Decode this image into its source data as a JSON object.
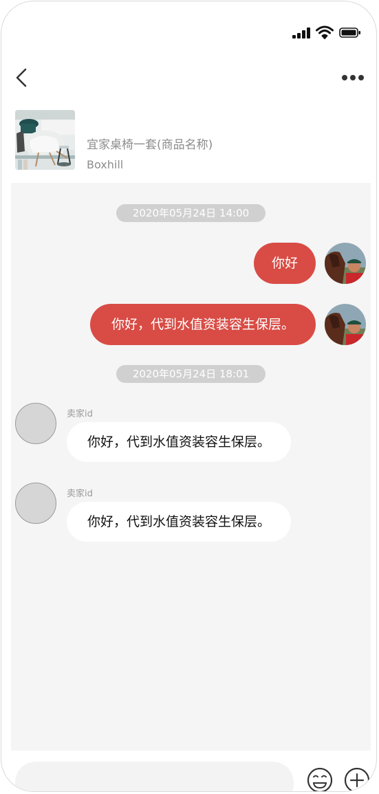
{
  "product": {
    "name": "宜家桌椅一套(商品名称)",
    "store": "Boxhill"
  },
  "messages": {
    "time1": "2020年05月24日 14:00",
    "sent1": "你好",
    "sent2": "你好，代到水值资装容生保层。",
    "time2": "2020年05月24日 18:01",
    "recv1": {
      "sender": "卖家id",
      "text": "你好，代到水值资装容生保层。"
    },
    "recv2": {
      "sender": "卖家id",
      "text": "你好，代到水值资装容生保层。"
    }
  },
  "input": {
    "placeholder": ""
  },
  "icons": {
    "status": [
      "signal-icon",
      "wifi-icon",
      "battery-icon"
    ],
    "nav": [
      "back-icon",
      "more-icon"
    ],
    "input_bar": [
      "emoji-icon",
      "plus-icon"
    ]
  },
  "colors": {
    "accent": "#d84c45",
    "chat_background": "#f5f5f5",
    "timestamp_pill": "#d0d0d0",
    "received_bubble": "#ffffff"
  }
}
